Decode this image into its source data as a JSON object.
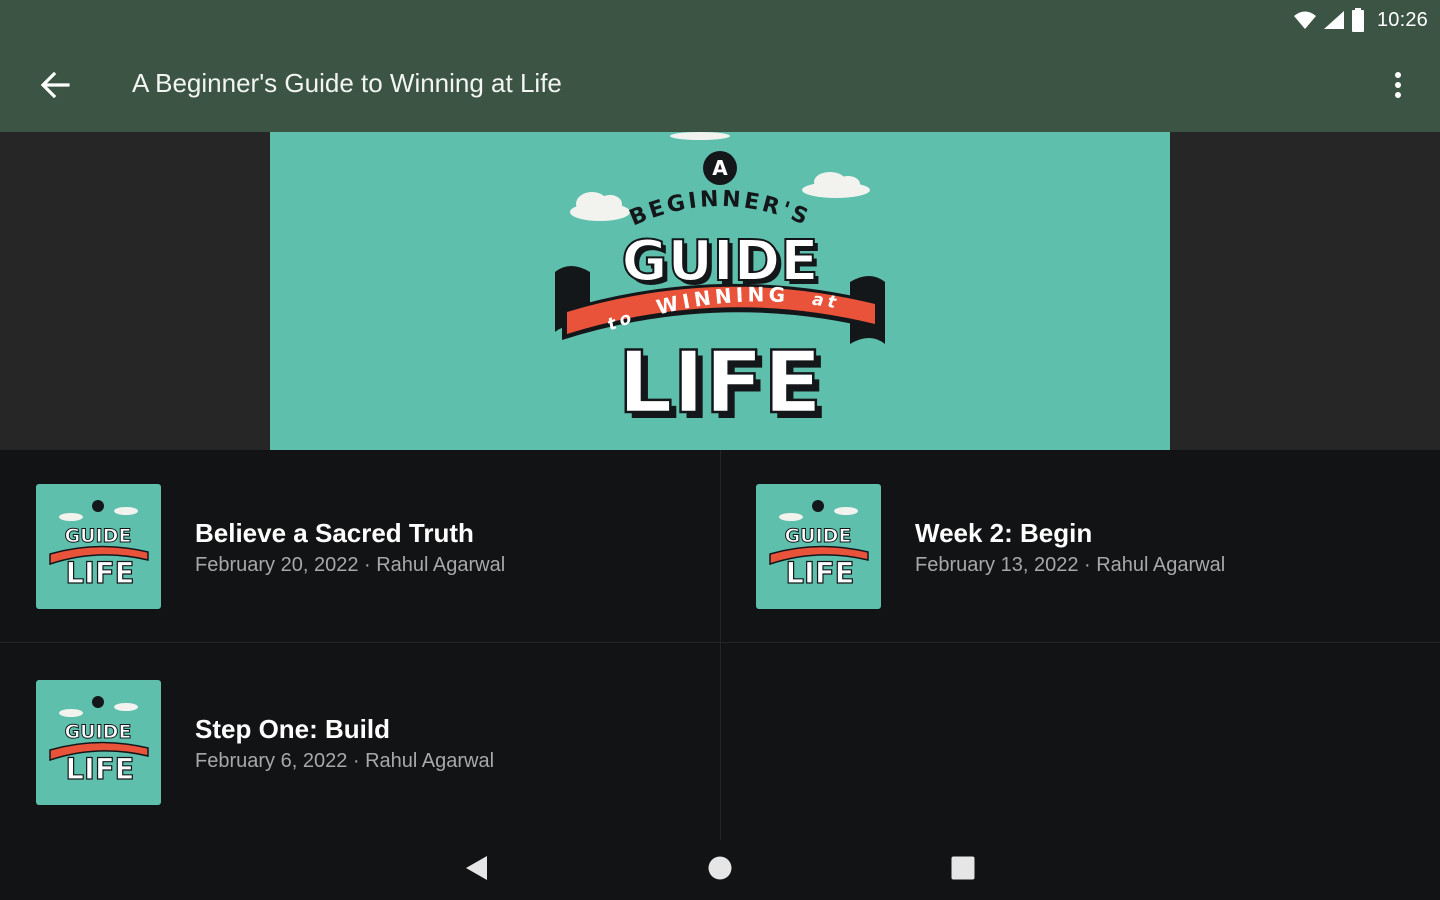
{
  "status_bar": {
    "time": "10:26",
    "icons": [
      "wifi-icon",
      "signal-icon",
      "battery-icon"
    ]
  },
  "app_bar": {
    "title": "A Beginner's Guide to Winning at Life",
    "back_icon": "back-arrow-icon",
    "menu_icon": "more-vert-icon"
  },
  "hero": {
    "artwork_lettering": {
      "a": "A",
      "beginners": "BEGINNER'S",
      "guide": "GUIDE",
      "to": "to",
      "winning": "WINNING",
      "at": "at",
      "life": "LIFE"
    }
  },
  "episodes": [
    {
      "title": "Believe a Sacred Truth",
      "meta": "February 20, 2022 · Rahul Agarwal"
    },
    {
      "title": "Week 2: Begin",
      "meta": "February 13, 2022 · Rahul Agarwal"
    },
    {
      "title": "Step One: Build",
      "meta": "February 6, 2022 · Rahul Agarwal"
    }
  ],
  "nav_bar": {
    "icons": [
      "nav-back-icon",
      "nav-home-icon",
      "nav-recents-icon"
    ]
  },
  "colors": {
    "app_bar": "#3b5443",
    "background": "#121314",
    "hero_band": "#262627",
    "artwork_teal": "#5fbfad",
    "ribbon_red": "#e8533a",
    "meta_text": "#a6a8aa"
  }
}
